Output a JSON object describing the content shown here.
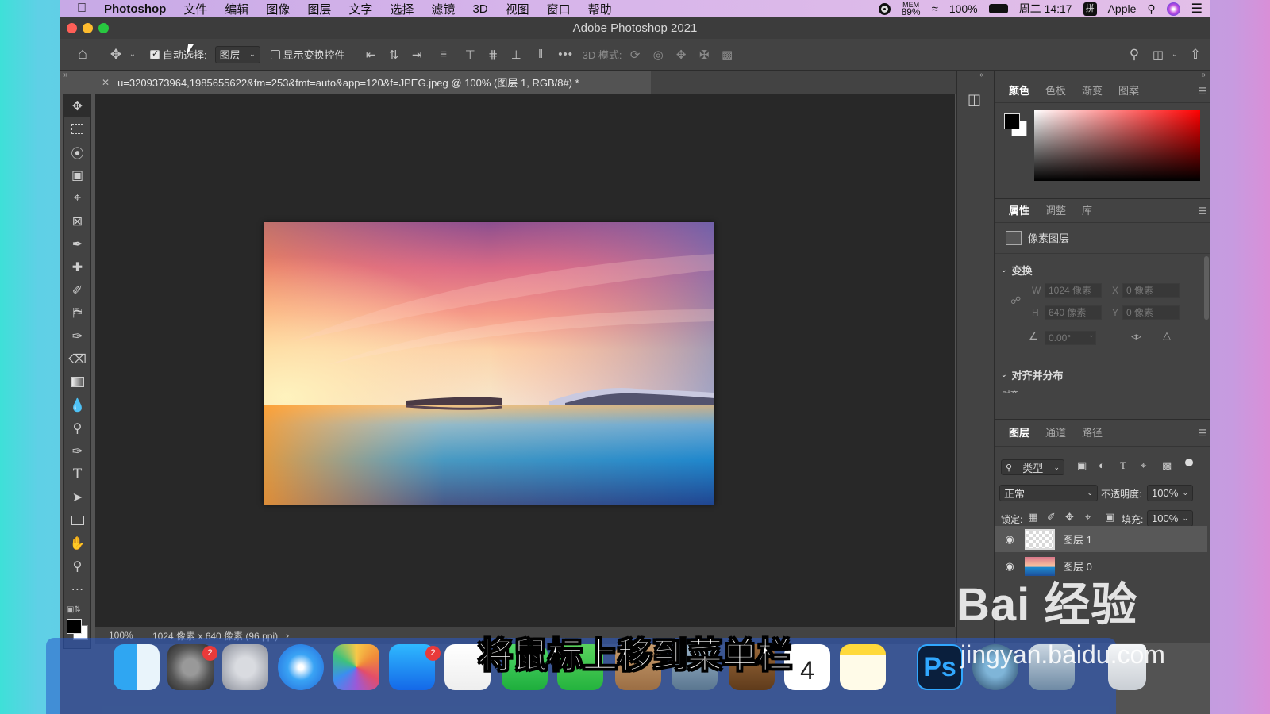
{
  "menubar": {
    "app": "Photoshop",
    "items": [
      "文件",
      "编辑",
      "图像",
      "图层",
      "文字",
      "选择",
      "滤镜",
      "3D",
      "视图",
      "窗口",
      "帮助"
    ],
    "status": {
      "mem_label": "MEM",
      "mem_value": "89%",
      "battery": "100%",
      "clock": "周二 14:17",
      "user": "Apple"
    }
  },
  "window": {
    "title": "Adobe Photoshop 2021"
  },
  "options": {
    "auto_select_label": "自动选择:",
    "auto_select_checked": true,
    "target_value": "图层",
    "show_transform_label": "显示变换控件",
    "show_transform_checked": false,
    "more_label": "•••",
    "mode_3d_label": "3D 模式:"
  },
  "document": {
    "tab_title": "u=3209373964,1985655622&fm=253&fmt=auto&app=120&f=JPEG.jpeg @ 100% (图层 1, RGB/8#) *",
    "zoom": "100%",
    "info": "1024 像素 x 640 像素 (96 ppi)"
  },
  "panels": {
    "color_tabs": [
      "颜色",
      "色板",
      "渐变",
      "图案"
    ],
    "props_tabs": [
      "属性",
      "调整",
      "库"
    ],
    "layer_kind": "像素图层",
    "transform_title": "变换",
    "transform": {
      "w": "1024 像素",
      "x": "0 像素",
      "h": "640 像素",
      "y": "0 像素",
      "angle": "0.00°",
      "w_label": "W",
      "h_label": "H",
      "x_label": "X",
      "y_label": "Y"
    },
    "align_title": "对齐并分布",
    "align_sub": "对齐:",
    "layers_tabs": [
      "图层",
      "通道",
      "路径"
    ],
    "filter_kind": "类型",
    "blend_mode": "正常",
    "opacity_label": "不透明度:",
    "opacity": "100%",
    "lock_label": "锁定:",
    "fill_label": "填充:",
    "fill": "100%",
    "layers": [
      {
        "name": "图层 1",
        "selected": true
      },
      {
        "name": "图层 0",
        "selected": false
      }
    ]
  },
  "dock": {
    "badges": {
      "settings": "2",
      "appstore": "2"
    },
    "calendar_day": "4",
    "ps_label": "Ps"
  },
  "overlay": {
    "subtitle": "将鼠标上移到菜单栏",
    "watermark": "Bai 经验",
    "watermark_url": "jingyan.baidu.com"
  },
  "colors": {
    "accent": "#2b7cd3",
    "panel": "#434343",
    "canvas": "#282828"
  }
}
